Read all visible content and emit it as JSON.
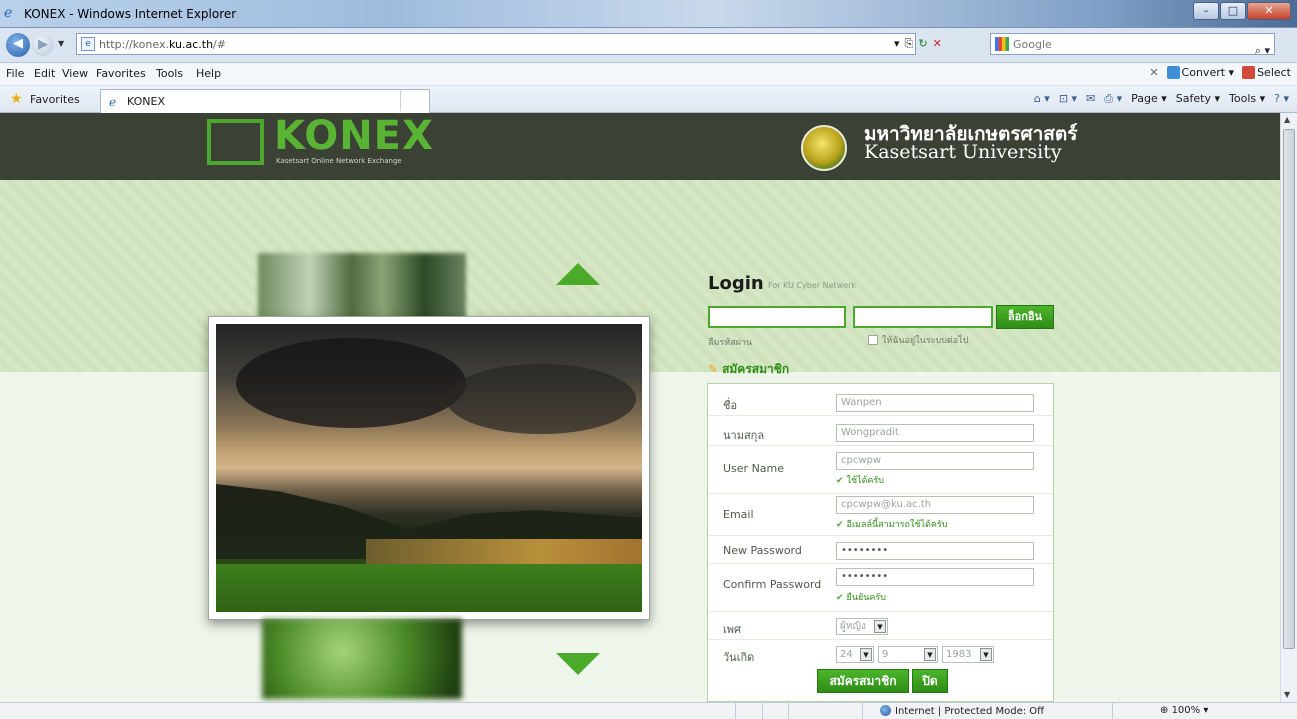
{
  "window": {
    "title": "KONEX - Windows Internet Explorer",
    "minimize": "–",
    "maximize": "□",
    "close": "✕"
  },
  "address": {
    "url_prefix": "http://konex.",
    "url_domain": "ku.ac.th",
    "url_suffix": "/#",
    "search_placeholder": "Google"
  },
  "menu": {
    "items": [
      "File",
      "Edit",
      "View",
      "Favorites",
      "Tools",
      "Help"
    ],
    "convert": "Convert ▾",
    "select": "Select"
  },
  "favbar": {
    "favorites": "Favorites",
    "tab_title": "KONEX",
    "commands": [
      "Page ▾",
      "Safety ▾",
      "Tools ▾"
    ]
  },
  "site": {
    "logo_text": "KONEX",
    "logo_sub": "Kasetsart Online Network Exchange",
    "ku_thai": "มหาวิทยาลัยเกษตรศาสตร์",
    "ku_eng": "Kasetsart University"
  },
  "login": {
    "title": "Login",
    "subtitle": "For KU Cyber Network",
    "button": "ล็อกอิน",
    "forgot": "ลืมรหัสผ่าน",
    "remember": "ให้ฉันอยู่ในระบบต่อไป",
    "register_heading": "สมัครสมาชิก"
  },
  "register": {
    "first_name_label": "ชื่อ",
    "first_name_value": "Wanpen",
    "last_name_label": "นามสกุล",
    "last_name_value": "Wongpradit",
    "username_label": "User Name",
    "username_value": "cpcwpw",
    "username_ok": "ใช้ได้ครับ",
    "email_label": "Email",
    "email_value": "cpcwpw@ku.ac.th",
    "email_ok": "อีเมลล์นี้สามารถใช้ได้ครับ",
    "new_password_label": "New Password",
    "new_password_value": "••••••••",
    "confirm_password_label": "Confirm Password",
    "confirm_password_value": "••••••••",
    "confirm_ok": "ยืนยันครับ",
    "gender_label": "เพศ",
    "gender_value": "ผู้หญิง",
    "birthday_label": "วันเกิด",
    "birth_day": "24",
    "birth_month": "9",
    "birth_year": "1983",
    "submit": "สมัครสมาชิก",
    "close": "ปิด"
  },
  "status": {
    "zone": "Internet | Protected Mode: Off",
    "zoom": "100%"
  },
  "colors": {
    "brand_green": "#4ca82c",
    "header_dark": "#3b4235"
  }
}
